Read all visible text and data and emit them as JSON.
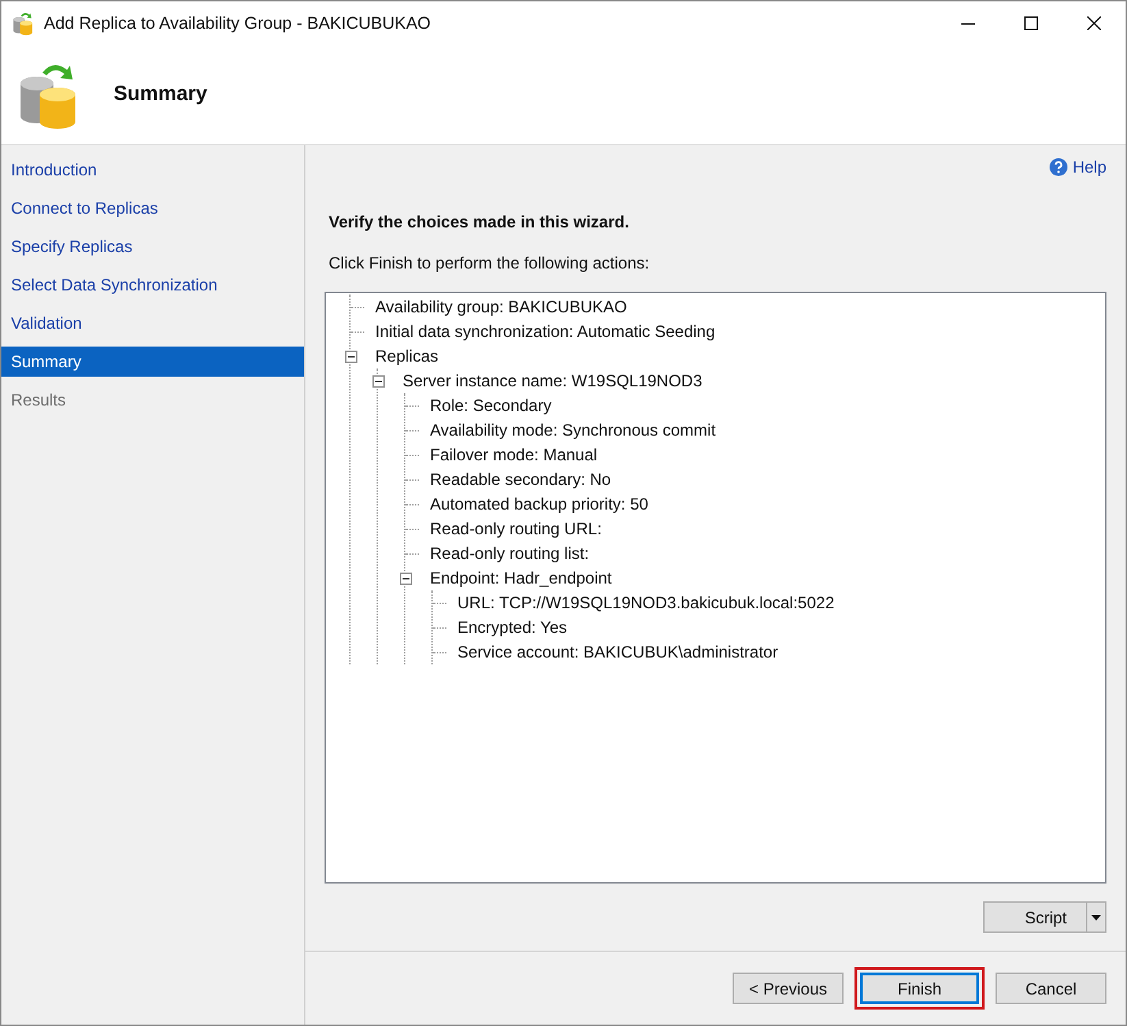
{
  "window": {
    "title": "Add Replica to Availability Group - BAKICUBUKAO"
  },
  "header": {
    "title": "Summary"
  },
  "steps": [
    {
      "label": "Introduction",
      "selected": false,
      "disabled": false
    },
    {
      "label": "Connect to Replicas",
      "selected": false,
      "disabled": false
    },
    {
      "label": "Specify Replicas",
      "selected": false,
      "disabled": false
    },
    {
      "label": "Select Data Synchronization",
      "selected": false,
      "disabled": false
    },
    {
      "label": "Validation",
      "selected": false,
      "disabled": false
    },
    {
      "label": "Summary",
      "selected": true,
      "disabled": false
    },
    {
      "label": "Results",
      "selected": false,
      "disabled": true
    }
  ],
  "help": {
    "label": "Help"
  },
  "heading": "Verify the choices made in this wizard.",
  "instruction": "Click Finish to perform the following actions:",
  "tree": {
    "items": [
      {
        "label": "Availability group: BAKICUBUKAO"
      },
      {
        "label": "Initial data synchronization: Automatic Seeding"
      },
      {
        "label": "Replicas",
        "expanded": true,
        "children": [
          {
            "label": "Server instance name: W19SQL19NOD3",
            "expanded": true,
            "children": [
              {
                "label": "Role: Secondary"
              },
              {
                "label": "Availability mode: Synchronous commit"
              },
              {
                "label": "Failover mode: Manual"
              },
              {
                "label": "Readable secondary: No"
              },
              {
                "label": "Automated backup priority: 50"
              },
              {
                "label": "Read-only routing URL:"
              },
              {
                "label": "Read-only routing list:"
              },
              {
                "label": "Endpoint: Hadr_endpoint",
                "expanded": true,
                "children": [
                  {
                    "label": "URL: TCP://W19SQL19NOD3.bakicubuk.local:5022"
                  },
                  {
                    "label": "Encrypted: Yes"
                  },
                  {
                    "label": "Service account: BAKICUBUK\\administrator"
                  }
                ]
              }
            ]
          }
        ]
      }
    ]
  },
  "script_button": {
    "label": "Script"
  },
  "buttons": [
    {
      "label": "< Previous",
      "default": false,
      "highlighted": false
    },
    {
      "label": "Finish",
      "default": true,
      "highlighted": true
    },
    {
      "label": "Cancel",
      "default": false,
      "highlighted": false
    }
  ]
}
